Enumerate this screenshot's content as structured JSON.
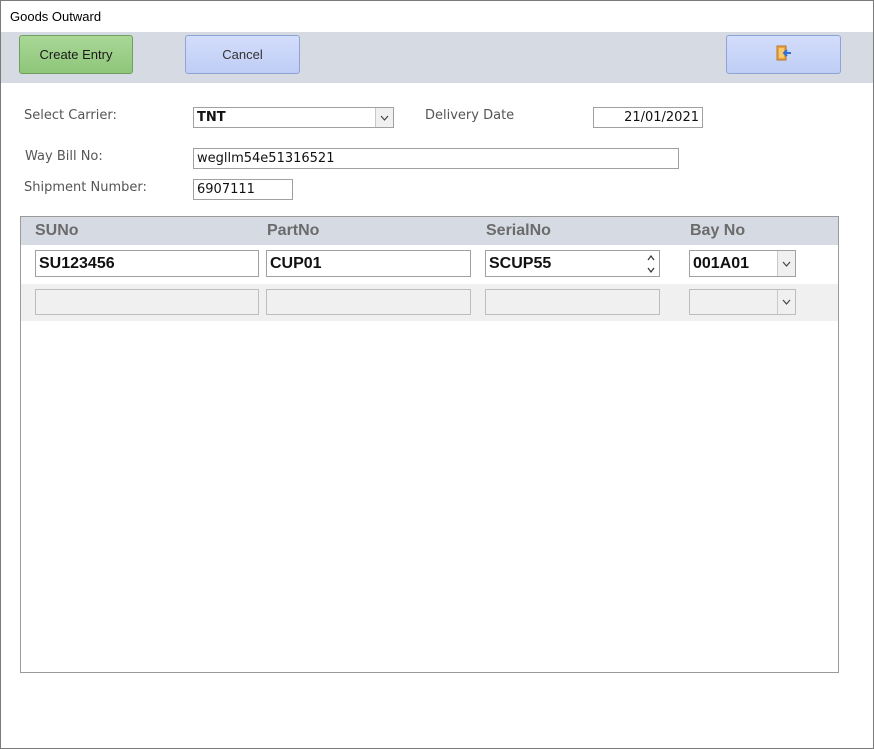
{
  "window": {
    "title": "Goods Outward"
  },
  "toolbar": {
    "create_label": "Create Entry",
    "cancel_label": "Cancel",
    "exit_icon": "exit-door-icon"
  },
  "form": {
    "carrier_label": "Select Carrier:",
    "carrier_value": "TNT",
    "delivery_date_label": "Delivery Date",
    "delivery_date_value": "21/01/2021",
    "waybill_label": "Way Bill No:",
    "waybill_value": "wegllm54e51316521",
    "shipment_label": "Shipment Number:",
    "shipment_value": "6907111"
  },
  "grid": {
    "columns": [
      "SUNo",
      "PartNo",
      "SerialNo",
      "Bay No"
    ],
    "rows": [
      {
        "suno": "SU123456",
        "partno": "CUP01",
        "serialno": "SCUP55",
        "bayno": "001A01"
      }
    ]
  }
}
